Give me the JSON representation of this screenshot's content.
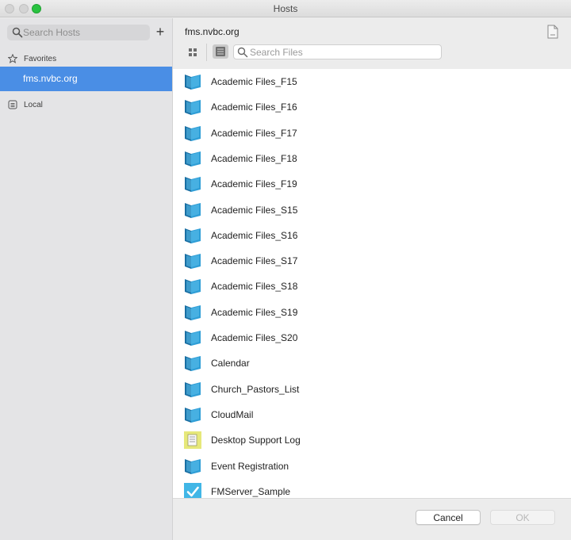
{
  "window": {
    "title": "Hosts"
  },
  "sidebar": {
    "search_placeholder": "Search Hosts",
    "add_label": "+",
    "favorites_label": "Favorites",
    "favorites": [
      {
        "label": "fms.nvbc.org",
        "selected": true
      }
    ],
    "local_label": "Local"
  },
  "main": {
    "host_title": "fms.nvbc.org",
    "search_placeholder": "Search Files",
    "view_mode": "list",
    "files": [
      {
        "name": "Academic Files_F15",
        "icon": "filemaker-folder-icon"
      },
      {
        "name": "Academic Files_F16",
        "icon": "filemaker-folder-icon"
      },
      {
        "name": "Academic Files_F17",
        "icon": "filemaker-folder-icon"
      },
      {
        "name": "Academic Files_F18",
        "icon": "filemaker-folder-icon"
      },
      {
        "name": "Academic Files_F19",
        "icon": "filemaker-folder-icon"
      },
      {
        "name": "Academic Files_S15",
        "icon": "filemaker-folder-icon"
      },
      {
        "name": "Academic Files_S16",
        "icon": "filemaker-folder-icon"
      },
      {
        "name": "Academic Files_S17",
        "icon": "filemaker-folder-icon"
      },
      {
        "name": "Academic Files_S18",
        "icon": "filemaker-folder-icon"
      },
      {
        "name": "Academic Files_S19",
        "icon": "filemaker-folder-icon"
      },
      {
        "name": "Academic Files_S20",
        "icon": "filemaker-folder-icon"
      },
      {
        "name": "Calendar",
        "icon": "filemaker-folder-icon"
      },
      {
        "name": "Church_Pastors_List",
        "icon": "filemaker-folder-icon"
      },
      {
        "name": "CloudMail",
        "icon": "filemaker-folder-icon"
      },
      {
        "name": "Desktop Support Log",
        "icon": "log-document-icon"
      },
      {
        "name": "Event Registration",
        "icon": "filemaker-folder-icon"
      },
      {
        "name": "FMServer_Sample",
        "icon": "checkmark-file-icon"
      }
    ]
  },
  "footer": {
    "cancel_label": "Cancel",
    "ok_label": "OK"
  },
  "colors": {
    "selection": "#4a8ee5",
    "folder_primary": "#2f9ed6",
    "folder_dark": "#1a6fa3",
    "log_icon": "#e6e87a",
    "check_icon": "#41b6e6"
  }
}
